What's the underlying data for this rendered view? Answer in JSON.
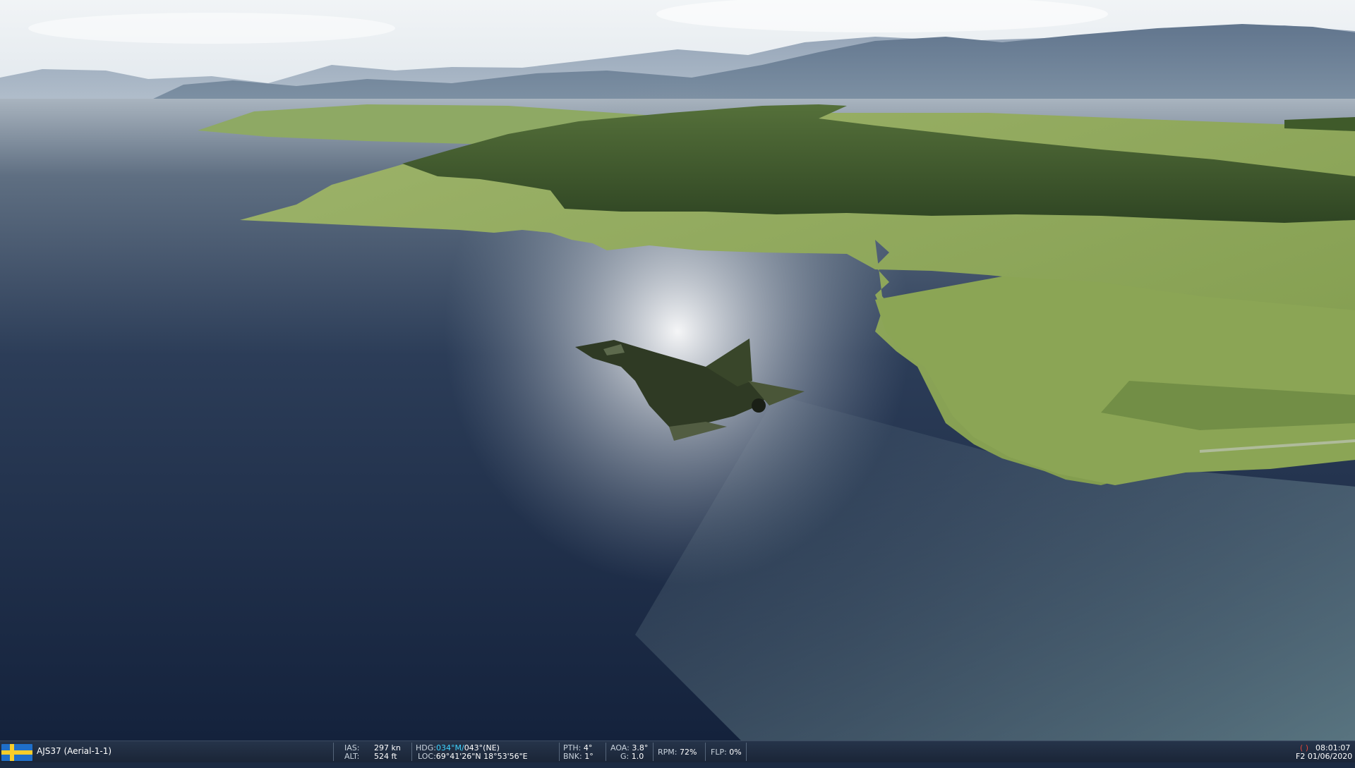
{
  "scene": {
    "description_icon": "aircraft-over-fjord",
    "colors": {
      "sky": "#e9eef2",
      "water_deep": "#13243f",
      "water_mid": "#4c5d72",
      "land": "#8aa45a",
      "forest": "#3f5a2a",
      "mountain": "#7d8fa3"
    }
  },
  "status": {
    "flag_icon": "sweden-flag-icon",
    "unit": "AJS37 (Aerial-1-1)",
    "ias_label": "IAS:",
    "ias_value": "297",
    "ias_unit": "kn",
    "alt_label": "ALT:",
    "alt_value": "524",
    "alt_unit": "ft",
    "hdg_label": "HDG:",
    "hdg_mag": "034°M/",
    "hdg_true": "043°(NE)",
    "loc_label": "LOC:",
    "loc_value": "69°41'26\"N 18°53'56\"E",
    "pth_label": "PTH:",
    "pth_value": "4°",
    "bnk_label": "BNK:",
    "bnk_value": "1°",
    "aoa_label": "AOA:",
    "aoa_value": "3.8°",
    "g_label": "G:",
    "g_value": "1.0",
    "rpm_label": "RPM:",
    "rpm_value": "72%",
    "flp_label": "FLP:",
    "flp_value": "0%",
    "rec_icon": "( )",
    "time": "08:01:07",
    "date": "F2 01/06/2020"
  }
}
